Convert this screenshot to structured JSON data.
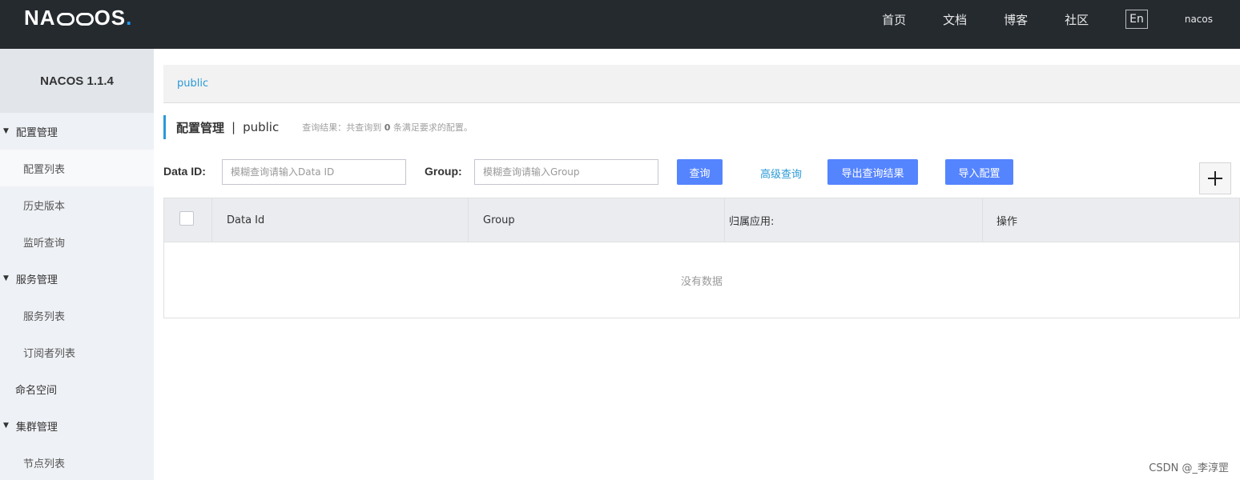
{
  "header": {
    "logo": {
      "part1": "NA",
      "part2": "OS",
      "dot": "."
    },
    "nav": [
      "首页",
      "文档",
      "博客",
      "社区"
    ],
    "lang": "En",
    "user": "nacos"
  },
  "sidebar": {
    "version": "NACOS 1.1.4",
    "groups": [
      {
        "label": "配置管理",
        "items": [
          "配置列表",
          "历史版本",
          "监听查询"
        ]
      },
      {
        "label": "服务管理",
        "items": [
          "服务列表",
          "订阅者列表"
        ]
      },
      {
        "top_item": "命名空间"
      },
      {
        "label": "集群管理",
        "items": [
          "节点列表"
        ]
      }
    ]
  },
  "main": {
    "namespace_crumb": "public",
    "title": "配置管理",
    "separator": "|",
    "namespace": "public",
    "result_prefix": "查询结果：共查询到",
    "result_count": "0",
    "result_suffix": "条满足要求的配置。",
    "filter": {
      "data_id_label": "Data ID:",
      "data_id_placeholder": "模糊查询请输入Data ID",
      "group_label": "Group:",
      "group_placeholder": "模糊查询请输入Group",
      "query_button": "查询",
      "advanced_link": "高级查询",
      "export_button": "导出查询结果",
      "import_button": "导入配置"
    },
    "table": {
      "columns": [
        "Data Id",
        "Group",
        "归属应用:",
        "操作"
      ],
      "empty_text": "没有数据"
    }
  },
  "watermark": "CSDN @_李淳罡",
  "colors": {
    "accent": "#2a9ad6",
    "primary_button": "#5584ff",
    "header_bg": "#252a2f"
  }
}
